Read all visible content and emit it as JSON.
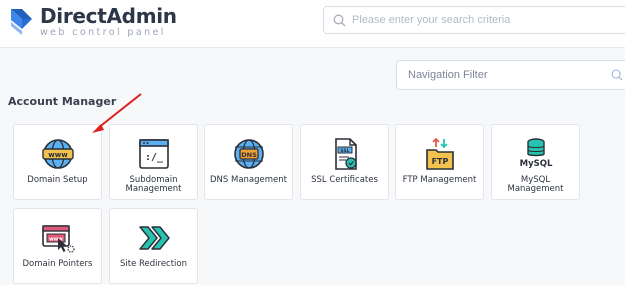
{
  "header": {
    "brand": "DirectAdmin",
    "tagline": "web control panel",
    "search_placeholder": "Please enter your search criteria"
  },
  "nav_filter": {
    "placeholder": "Navigation Filter"
  },
  "section": {
    "title": "Account Manager"
  },
  "tiles": [
    {
      "label": "Domain Setup",
      "icon": "www-globe-icon"
    },
    {
      "label": "Subdomain Management",
      "icon": "subdomain-terminal-icon"
    },
    {
      "label": "DNS Management",
      "icon": "dns-globe-icon"
    },
    {
      "label": "SSL Certificates",
      "icon": "ssl-certificate-icon"
    },
    {
      "label": "FTP Management",
      "icon": "ftp-folder-icon"
    },
    {
      "label": "MySQL Management",
      "icon": "mysql-database-icon"
    },
    {
      "label": "Domain Pointers",
      "icon": "domain-pointer-icon"
    },
    {
      "label": "Site Redirection",
      "icon": "redirect-arrows-icon"
    }
  ],
  "colors": {
    "accent": "#2f6fd1",
    "arrow": "#e02020",
    "teal": "#26c4b0",
    "dark": "#2b2f38",
    "orange": "#f2a134"
  }
}
